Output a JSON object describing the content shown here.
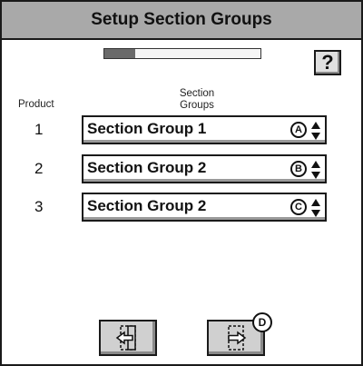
{
  "window": {
    "title": "Setup Section Groups"
  },
  "progress": {
    "fraction": 0.2
  },
  "help": {
    "label": "?"
  },
  "headers": {
    "product": "Product",
    "section_groups_line1": "Section",
    "section_groups_line2": "Groups"
  },
  "rows": [
    {
      "product": "1",
      "group": "Section Group 1",
      "callout": "A"
    },
    {
      "product": "2",
      "group": "Section Group 2",
      "callout": "B"
    },
    {
      "product": "3",
      "group": "Section Group 2",
      "callout": "C"
    }
  ],
  "nav": {
    "next_callout": "D",
    "back_icon": "exit-arrow-left-icon",
    "next_icon": "enter-arrow-right-icon"
  },
  "colors": {
    "title_bar": "#a9a9a9",
    "progress_fill": "#6a6a6a",
    "button_face": "#d0d0d0"
  }
}
